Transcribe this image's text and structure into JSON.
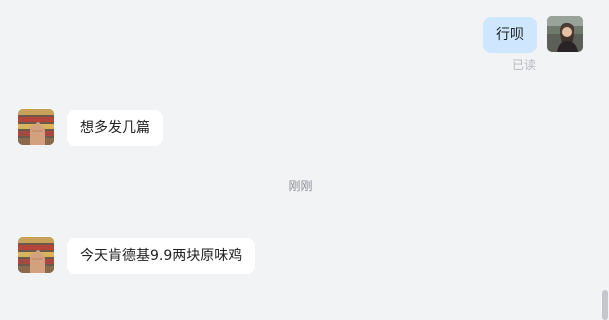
{
  "messages": {
    "outgoing": {
      "text": "行呗",
      "status": "已读",
      "bubble_color": "#cfe6ff"
    },
    "incoming_1": {
      "text": "想多发几篇"
    },
    "timestamp": "刚刚",
    "incoming_2": {
      "text": "今天肯德基9.9两块原味鸡"
    }
  },
  "icons": {
    "self_avatar": "user-avatar-photo",
    "contact_avatar": "contact-avatar-photo"
  },
  "colors": {
    "background": "#f2f3f5",
    "incoming_bubble": "#ffffff",
    "outgoing_bubble": "#cfe6ff"
  }
}
